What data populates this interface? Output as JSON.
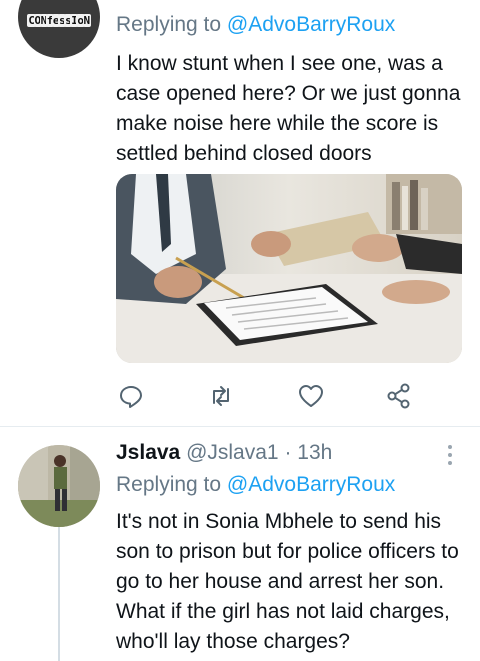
{
  "tweets": [
    {
      "avatar_label": "CONfessIoN",
      "replying_prefix": "Replying to",
      "replying_handle": "@AdvoBarryRoux",
      "text": "I know stunt when I see one, was a case opened here? Or we just gonna make noise here while the score is settled behind closed doors",
      "image_icon": "photo-handing-envelope-contract",
      "actions": [
        "reply-icon",
        "retweet-icon",
        "like-icon",
        "share-icon"
      ]
    },
    {
      "display_name": "Jslava",
      "handle": "@Jslava1",
      "separator": "·",
      "time": "13h",
      "replying_prefix": "Replying to",
      "replying_handle": "@AdvoBarryRoux",
      "text": "It's not in Sonia Mbhele to send his son to prison but for police officers to go to her house and arrest her son. What if the girl has not laid charges, who'll lay those charges?",
      "more_icon": "more-vertical-icon"
    }
  ],
  "colors": {
    "link": "#1da1f2",
    "secondary": "#657786",
    "text": "#0f1419",
    "divider": "#e6ecf0"
  }
}
